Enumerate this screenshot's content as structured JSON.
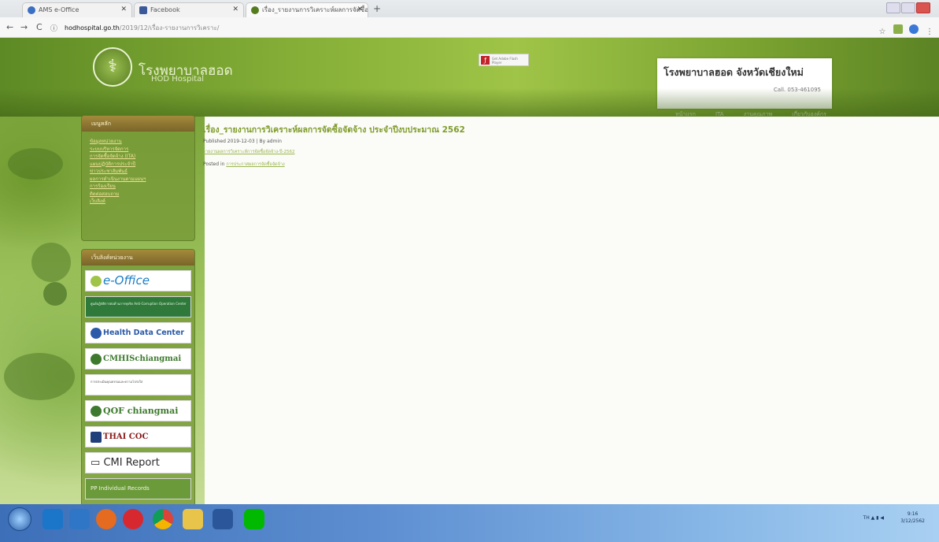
{
  "browser": {
    "tabs": [
      {
        "label": "AMS e-Office",
        "active": false
      },
      {
        "label": "Facebook",
        "active": false
      },
      {
        "label": "เรื่อง_รายงานการวิเคราะห์ผลการจัดซื้อ",
        "active": true
      }
    ],
    "new_tab": "+",
    "url_scheme_icon": "ⓘ",
    "url_host": "hodhospital.go.th",
    "url_path": "/2019/12/เรื่อง-รายงานการวิเคราะ/",
    "nav": {
      "back": "←",
      "forward": "→",
      "reload": "C"
    },
    "ext_icons": [
      "star-icon",
      "extension-icon",
      "profile-icon",
      "menu-icon"
    ]
  },
  "header": {
    "site_name": "โรงพยาบาลฮอด",
    "site_sub": "HOD Hospital",
    "flash_badge": "Get Adobe Flash Player",
    "hospital_title": "โรงพยาบาลฮอด จังหวัดเชียงใหม่",
    "call": "Call. 053-461095",
    "nav_items": [
      "หน้าแรก",
      "ITA",
      "งานคุณภาพ",
      "เกี่ยวกับองค์กร"
    ]
  },
  "sidebar": {
    "menu_title": "เมนูหลัก",
    "menu_items": [
      "ข้อมูลหน่วยงาน",
      "ระบบบริหารจัดการ",
      "การจัดซื้อจัดจ้าง (ITA)",
      "แผนปฏิบัติการประจำปี",
      "ข่าวประชาสัมพันธ์",
      "ผลการดำเนินงานตามแผนฯ",
      "การร้องเรียน",
      "ติดต่อสอบถาม",
      "เว็บลิงค์"
    ],
    "links_title": "เว็บลิงค์หน่วยงาน",
    "banners": [
      {
        "label": "e-Office",
        "color": "#1a7dc4"
      },
      {
        "label": "ศูนย์ปฏิบัติการต่อต้านการทุจริต Anti-Corruption Operation Center",
        "color": "#2a6f34"
      },
      {
        "label": "Health Data Center",
        "color": "#2b5aa8"
      },
      {
        "label": "CMHISchiangmai",
        "color": "#3d7a2e"
      },
      {
        "label": "การประเมินคุณธรรมและความโปร่งใส",
        "color": "#555555"
      },
      {
        "label": "QOF chiangmai",
        "color": "#3d7a2e"
      },
      {
        "label": "THAI COC",
        "color": "#8a1a1a"
      },
      {
        "label": "CMI Report",
        "color": "#222222"
      },
      {
        "label": "PP Individual Records",
        "color": "#2a6f34"
      }
    ]
  },
  "content": {
    "title": "เรื่อง_รายงานการวิเคราะห์ผลการจัดซื้อจัดจ้าง ประจำปีงบประมาณ 2562",
    "published": "Published 2019-12-03 | By admin",
    "link": "รายงานผลการวิเคราะห์การจัดซื้อจัดจ้าง-ปี-2562",
    "posted_in_label": "Posted in",
    "posted_in_category": "การประกาศผลการจัดซื้อจัดจ้าง"
  },
  "taskbar": {
    "apps": [
      "internet-explorer-icon",
      "media-icon",
      "firefox-icon",
      "opera-icon",
      "chrome-icon",
      "explorer-icon",
      "word-icon",
      "line-icon"
    ],
    "clock_time": "9:16",
    "clock_date": "3/12/2562",
    "tray_lang": "TH"
  }
}
